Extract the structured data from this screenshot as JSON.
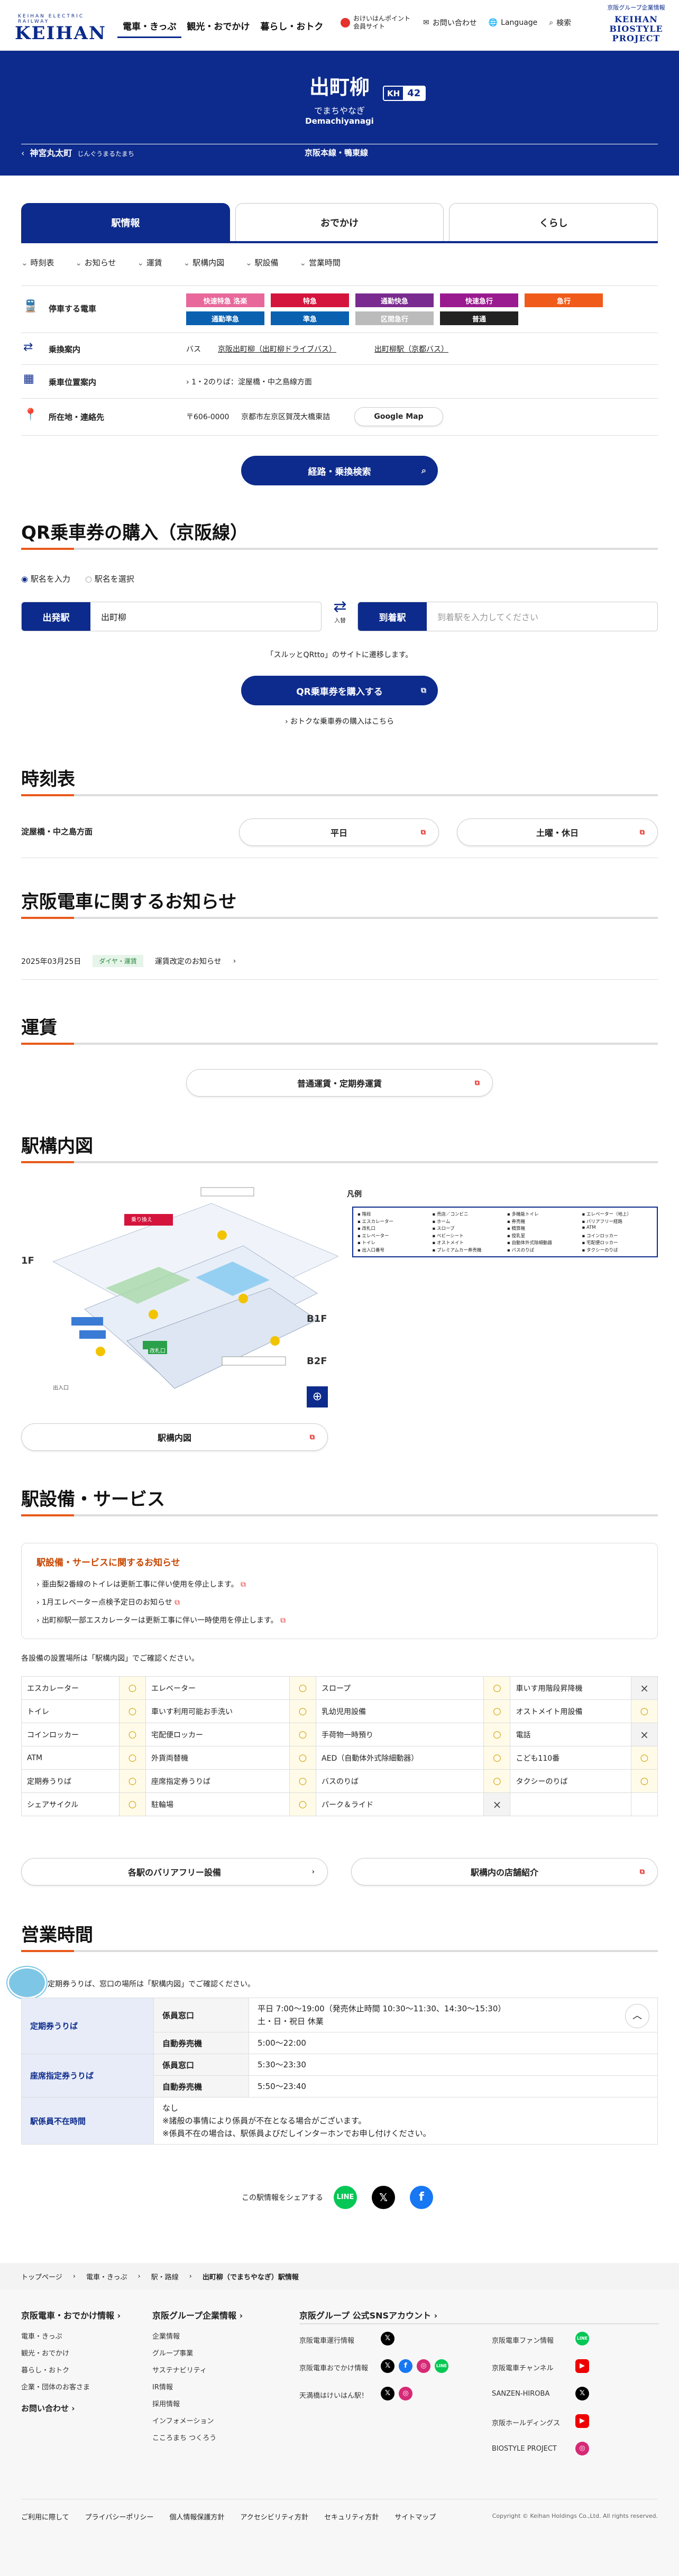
{
  "header": {
    "logo_small": "KEIHAN ELECTRIC RAILWAY",
    "logo": "KEIHAN",
    "nav": [
      "電車・きっぷ",
      "観光・おでかけ",
      "暮らし・おトク"
    ],
    "util": [
      "おけいはんポイント会員サイト",
      "お問い合わせ",
      "Language",
      "検索"
    ],
    "group": "京阪グループ企業情報",
    "bio": [
      "KEIHAN",
      "BIOSTYLE",
      "PROJECT"
    ]
  },
  "station": {
    "name": "出町柳",
    "kana": "でまちやなぎ",
    "roman": "Demachiyanagi",
    "code_prefix": "KH",
    "code_num": "42",
    "prev": "神宮丸太町",
    "prev_kana": "じんぐうまるたまち",
    "line": "京阪本線・鴨東線"
  },
  "tabs": [
    "駅情報",
    "おでかけ",
    "くらし"
  ],
  "anchors": [
    "時刻表",
    "お知らせ",
    "運賃",
    "駅構内図",
    "駅設備",
    "営業時間"
  ],
  "info": {
    "trains_label": "停車する電車",
    "trains": [
      {
        "name": "快速特急 洛楽",
        "color": "#e8689b"
      },
      {
        "name": "特急",
        "color": "#d4143c"
      },
      {
        "name": "通勤快急",
        "color": "#7a2b8f"
      },
      {
        "name": "快速急行",
        "color": "#9a1a8f"
      },
      {
        "name": "急行",
        "color": "#f05a1a"
      },
      {
        "name": "通勤準急",
        "color": "#0a61b0"
      },
      {
        "name": "準急",
        "color": "#0a61b0"
      },
      {
        "name": "区間急行",
        "color": "#bbbbbb"
      },
      {
        "name": "普通",
        "color": "#222222"
      }
    ],
    "transfer_label": "乗換案内",
    "transfer_bus": "バス",
    "transfer_1": "京阪出町柳（出町柳ドライブバス）",
    "transfer_2": "出町柳駅（京都バス）",
    "car_label": "乗車位置案内",
    "car_text": "1・2のりば：淀屋橋・中之島線方面",
    "addr_label": "所在地・連絡先",
    "addr_zip": "〒606-0000",
    "addr": "京都市左京区賀茂大橋東詰",
    "map_btn": "Google Map",
    "search_btn": "経路・乗換検索"
  },
  "qr": {
    "title": "QR乗車券の購入（京阪線）",
    "radio1": "駅名を入力",
    "radio2": "駅名を選択",
    "from_label": "出発駅",
    "from_val": "出町柳",
    "swap": "入替",
    "to_label": "到着駅",
    "to_ph": "到着駅を入力してください",
    "note": "「スルッとQRtto」のサイトに遷移します。",
    "buy_btn": "QR乗車券を購入する",
    "link": "おトクな乗車券の購入はこちら"
  },
  "timetable": {
    "title": "時刻表",
    "dir": "淀屋橋・中之島方面",
    "btn1": "平日",
    "btn2": "土曜・休日"
  },
  "notice": {
    "title": "京阪電車に関するお知らせ",
    "date": "2025年03月25日",
    "tag": "ダイヤ・運賃",
    "text": "運賃改定のお知らせ"
  },
  "fare": {
    "title": "運賃",
    "btn": "普通運賃・定期券運賃"
  },
  "map": {
    "title": "駅構内図",
    "btn": "駅構内図",
    "legend_title": "凡例",
    "legend": [
      "階段",
      "売店／コンビニ",
      "多機能トイレ",
      "エレベーター（地上）",
      "エスカレーター",
      "ホーム",
      "券売機",
      "バリアフリー経路",
      "改札口",
      "スロープ",
      "精算機",
      "ATM",
      "エレベーター",
      "ベビーシート",
      "授乳室",
      "コインロッカー",
      "トイレ",
      "オストメイト",
      "自動体外式除細動器",
      "宅配便ロッカー",
      "出入口番号",
      "プレミアムカー券売機",
      "バスのりば",
      "タクシーのりば"
    ],
    "labels": [
      "1F",
      "B1F",
      "B2F",
      "出入口",
      "改札口",
      "乗り換え"
    ]
  },
  "facility": {
    "title": "駅設備・サービス",
    "notice_title": "駅設備・サービスに関するお知らせ",
    "notices": [
      "亜由梨2番線のトイレは更新工事に伴い使用を停止します。",
      "1月エレベーター点検予定日のお知らせ",
      "出町柳駅一部エスカレーターは更新工事に伴い一時使用を停止します。"
    ],
    "intro": "各設備の設置場所は「駅構内図」でご確認ください。",
    "rows": [
      [
        [
          "エスカレーター",
          "○"
        ],
        [
          "エレベーター",
          "○"
        ],
        [
          "スロープ",
          "○"
        ],
        [
          "車いす用階段昇降機",
          "×"
        ]
      ],
      [
        [
          "トイレ",
          "○"
        ],
        [
          "車いす利用可能お手洗い",
          "○"
        ],
        [
          "乳幼児用設備",
          "○"
        ],
        [
          "オストメイト用設備",
          "○"
        ]
      ],
      [
        [
          "コインロッカー",
          "○"
        ],
        [
          "宅配便ロッカー",
          "○"
        ],
        [
          "手荷物一時預り",
          "○"
        ],
        [
          "電話",
          "×"
        ]
      ],
      [
        [
          "ATM",
          "○"
        ],
        [
          "外貨両替機",
          "○"
        ],
        [
          "AED（自動体外式除細動器）",
          "○"
        ],
        [
          "こども110番",
          "○"
        ]
      ],
      [
        [
          "定期券うりば",
          "○"
        ],
        [
          "座席指定券うりば",
          "○"
        ],
        [
          "バスのりば",
          "○"
        ],
        [
          "タクシーのりば",
          "○"
        ]
      ],
      [
        [
          "シェアサイクル",
          "○"
        ],
        [
          "駐輪場",
          "○"
        ],
        [
          "パーク＆ライド",
          "×"
        ],
        [
          "",
          ""
        ]
      ]
    ],
    "btn1": "各駅のバリアフリー設備",
    "btn2": "駅構内の店舗紹介"
  },
  "hours": {
    "title": "営業時間",
    "intro": "定期券うりば、窓口の場所は「駅構内図」でご確認ください。",
    "rows": [
      {
        "h": "定期券うりば",
        "s": "係員窓口",
        "v": "平日 7:00〜19:00（発売休止時間 10:30〜11:30、14:30〜15:30）\n土・日・祝日 休業"
      },
      {
        "h": "",
        "s": "自動券売機",
        "v": "5:00〜22:00"
      },
      {
        "h": "座席指定券うりば",
        "s": "係員窓口",
        "v": "5:30〜23:30"
      },
      {
        "h": "",
        "s": "自動券売機",
        "v": "5:50〜23:40"
      },
      {
        "h": "駅係員不在時間",
        "s": "",
        "v": "なし\n※諸般の事情により係員が不在となる場合がございます。\n※係員不在の場合は、駅係員よびだしインターホンでお申し付けください。"
      }
    ]
  },
  "share": {
    "text": "この駅情報をシェアする"
  },
  "breadcrumb": [
    "トップページ",
    "電車・きっぷ",
    "駅・路線",
    "出町柳（でまちやなぎ）駅情報"
  ],
  "footer": {
    "col1_title": "京阪電車・おでかけ情報",
    "col1": [
      "電車・きっぷ",
      "観光・おでかけ",
      "暮らし・おトク",
      "企業・団体のお客さま"
    ],
    "contact": "お問い合わせ",
    "col2_title": "京阪グループ企業情報",
    "col2": [
      "企業情報",
      "グループ事業",
      "サステナビリティ",
      "IR情報",
      "採用情報",
      "インフォメーション",
      "こころまち つくろう"
    ],
    "col3_title": "京阪グループ 公式SNSアカウント",
    "sns_left": [
      "京阪電車運行情報",
      "京阪電車おでかけ情報",
      "天満橋はけいはん駅！"
    ],
    "sns_right": [
      "京阪電車ファン情報",
      "京阪電車チャンネル",
      "SANZEN-HIROBA",
      "京阪ホールディングス",
      "BIOSTYLE PROJECT"
    ],
    "bottom": [
      "ご利用に際して",
      "プライバシーポリシー",
      "個人情報保護方針",
      "アクセシビリティ方針",
      "セキュリティ方針",
      "サイトマップ"
    ],
    "copyright": "Copyright © Keihan Holdings Co.,Ltd. All rights reserved."
  }
}
